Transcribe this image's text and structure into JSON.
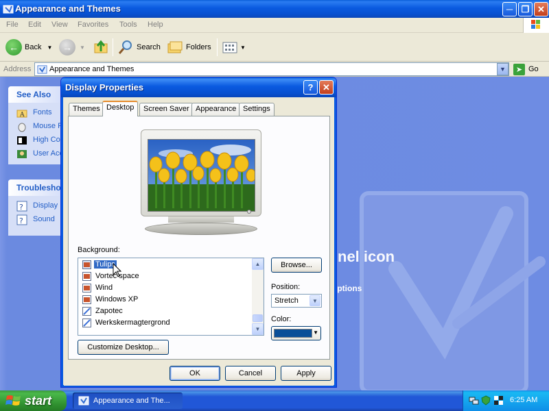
{
  "explorer": {
    "title": "Appearance and Themes",
    "menu": [
      "File",
      "Edit",
      "View",
      "Favorites",
      "Tools",
      "Help"
    ],
    "toolbar": {
      "back": "Back",
      "search": "Search",
      "folders": "Folders"
    },
    "address": {
      "label": "Address",
      "value": "Appearance and Themes",
      "go": "Go"
    },
    "see_also": {
      "title": "See Also",
      "items": [
        "Fonts",
        "Mouse P",
        "High Cor",
        "User Acc"
      ]
    },
    "troubleshooters": {
      "title": "Troubleshoo",
      "items": [
        "Display",
        "Sound"
      ]
    },
    "background_heading": "nel icon",
    "background_link": "Options"
  },
  "dialog": {
    "title": "Display Properties",
    "tabs": [
      "Themes",
      "Desktop",
      "Screen Saver",
      "Appearance",
      "Settings"
    ],
    "active_tab": "Desktop",
    "background_label": "Background:",
    "backgrounds": [
      "Tulips",
      "Vortec space",
      "Wind",
      "Windows XP",
      "Zapotec",
      "Werkskermagtergrond"
    ],
    "selected_background": "Tulips",
    "browse": "Browse...",
    "position_label": "Position:",
    "position_value": "Stretch",
    "color_label": "Color:",
    "color_value": "#0a4f98",
    "customize": "Customize Desktop...",
    "ok": "OK",
    "cancel": "Cancel",
    "apply": "Apply"
  },
  "taskbar": {
    "start": "start",
    "task": "Appearance and The...",
    "clock": "6:25 AM"
  },
  "colors": {
    "xp_blue": "#0a5ae0",
    "selection": "#316ac5",
    "start_green": "#3c9b3c"
  }
}
